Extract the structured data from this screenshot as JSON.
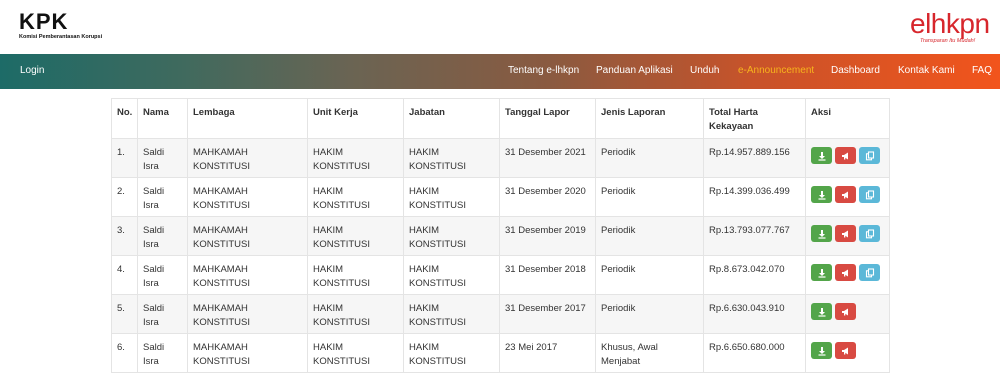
{
  "header": {
    "kpk_logo_text": "KPK",
    "kpk_subtitle": "Komisi Pemberantasan Korupsi",
    "elhkpn_logo_text": "elhkpn",
    "elhkpn_tagline": "Transparan Itu Mudah!"
  },
  "nav": {
    "login": "Login",
    "items": [
      {
        "label": "Tentang e-lhkpn"
      },
      {
        "label": "Panduan Aplikasi"
      },
      {
        "label": "Unduh"
      },
      {
        "label": "e-Announcement",
        "active": true
      },
      {
        "label": "Dashboard"
      },
      {
        "label": "Kontak Kami"
      },
      {
        "label": "FAQ"
      }
    ],
    "active_color": "#f7b31d"
  },
  "table": {
    "headers": [
      "No.",
      "Nama",
      "Lembaga",
      "Unit Kerja",
      "Jabatan",
      "Tanggal Lapor",
      "Jenis Laporan",
      "Total Harta Kekayaan",
      "Aksi"
    ],
    "rows": [
      {
        "no": "1.",
        "nama": "Saldi Isra",
        "lembaga": "MAHKAMAH KONSTITUSI",
        "unit": "HAKIM KONSTITUSI",
        "jabatan": "HAKIM KONSTITUSI",
        "tanggal": "31 Desember 2021",
        "jenis": "Periodik",
        "total": "Rp.14.957.889.156",
        "actions": [
          "download-icon",
          "announcement-icon",
          "copy-icon"
        ]
      },
      {
        "no": "2.",
        "nama": "Saldi Isra",
        "lembaga": "MAHKAMAH KONSTITUSI",
        "unit": "HAKIM KONSTITUSI",
        "jabatan": "HAKIM KONSTITUSI",
        "tanggal": "31 Desember 2020",
        "jenis": "Periodik",
        "total": "Rp.14.399.036.499",
        "actions": [
          "download-icon",
          "announcement-icon",
          "copy-icon"
        ]
      },
      {
        "no": "3.",
        "nama": "Saldi Isra",
        "lembaga": "MAHKAMAH KONSTITUSI",
        "unit": "HAKIM KONSTITUSI",
        "jabatan": "HAKIM KONSTITUSI",
        "tanggal": "31 Desember 2019",
        "jenis": "Periodik",
        "total": "Rp.13.793.077.767",
        "actions": [
          "download-icon",
          "announcement-icon",
          "copy-icon"
        ]
      },
      {
        "no": "4.",
        "nama": "Saldi Isra",
        "lembaga": "MAHKAMAH KONSTITUSI",
        "unit": "HAKIM KONSTITUSI",
        "jabatan": "HAKIM KONSTITUSI",
        "tanggal": "31 Desember 2018",
        "jenis": "Periodik",
        "total": "Rp.8.673.042.070",
        "actions": [
          "download-icon",
          "announcement-icon",
          "copy-icon"
        ]
      },
      {
        "no": "5.",
        "nama": "Saldi Isra",
        "lembaga": "MAHKAMAH KONSTITUSI",
        "unit": "HAKIM KONSTITUSI",
        "jabatan": "HAKIM KONSTITUSI",
        "tanggal": "31 Desember 2017",
        "jenis": "Periodik",
        "total": "Rp.6.630.043.910",
        "actions": [
          "download-icon",
          "announcement-icon"
        ]
      },
      {
        "no": "6.",
        "nama": "Saldi Isra",
        "lembaga": "MAHKAMAH KONSTITUSI",
        "unit": "HAKIM KONSTITUSI",
        "jabatan": "HAKIM KONSTITUSI",
        "tanggal": "23 Mei 2017",
        "jenis": "Khusus, Awal Menjabat",
        "total": "Rp.6.650.680.000",
        "actions": [
          "download-icon",
          "announcement-icon"
        ]
      }
    ]
  },
  "colors": {
    "download": "#53a54a",
    "announcement": "#d84a42",
    "copy": "#5bb8d8",
    "brand_red": "#d7262c"
  }
}
